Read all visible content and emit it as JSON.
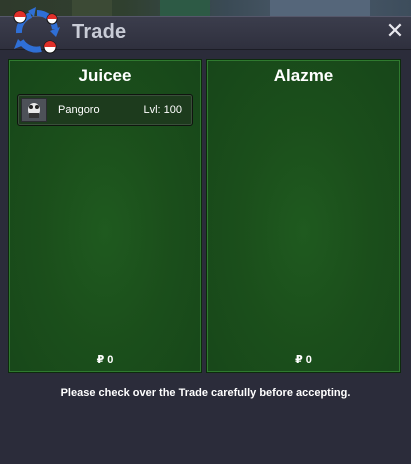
{
  "window": {
    "title": "Trade",
    "close_glyph": "✕"
  },
  "trade": {
    "left": {
      "player": "Juicee",
      "items": [
        {
          "icon": "pangoro-sprite-icon",
          "name": "Pangoro",
          "level": "Lvl: 100"
        }
      ],
      "currency_symbol": "₽",
      "money": "0"
    },
    "right": {
      "player": "Alazme",
      "items": [],
      "currency_symbol": "₽",
      "money": "0"
    }
  },
  "notice": "Please check over the Trade carefully before accepting.",
  "colors": {
    "panel_green": "#1b4f1b",
    "window_bg": "#2b2c3a",
    "title_text": "#c9ccd6"
  }
}
